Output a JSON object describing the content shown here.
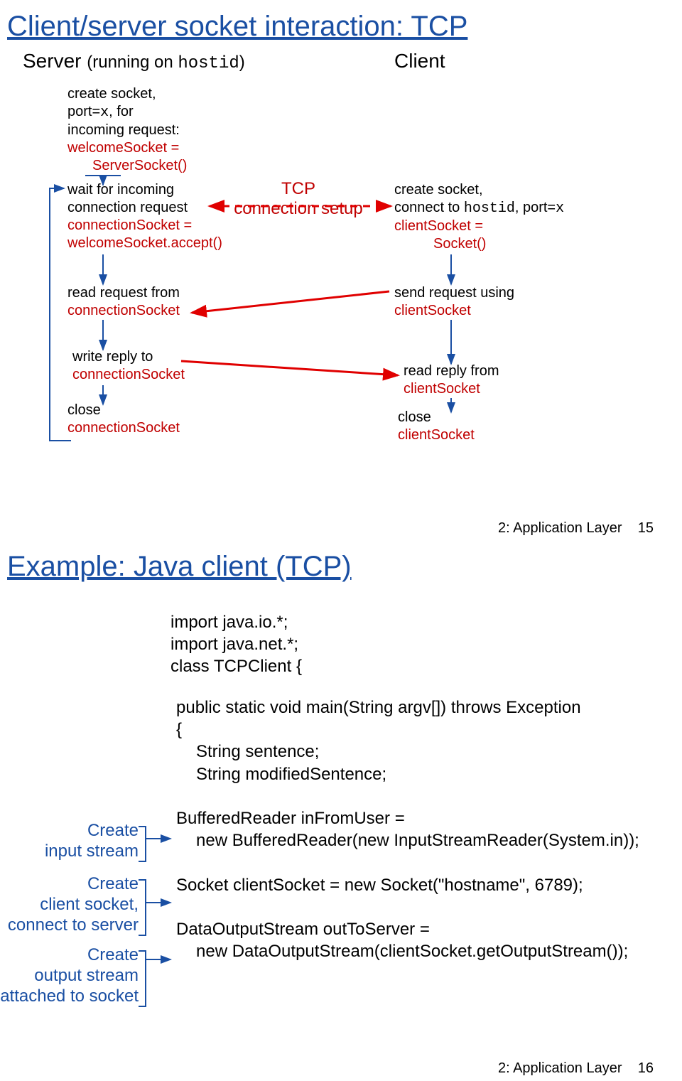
{
  "slide1": {
    "title": "Client/server socket interaction: TCP",
    "server_heading_pre": "Server ",
    "server_heading_paren_open": "(running on ",
    "server_heading_hostid": "hostid",
    "server_heading_paren_close": ")",
    "client_heading": "Client",
    "welcome": {
      "l1": "create socket,",
      "l2_pre": "port=",
      "l2_x": "x",
      "l2_post": ", for",
      "l3": "incoming request:",
      "l4a": "welcomeSocket =",
      "l4b": "ServerSocket()"
    },
    "wait": {
      "l1": "wait for incoming",
      "l2": "connection request",
      "l3": "connectionSocket =",
      "l4": "welcomeSocket.accept()"
    },
    "tcp_label_l1": "TCP",
    "tcp_label_l2": "connection setup",
    "client_create": {
      "l1": "create socket,",
      "l2_pre": "connect to ",
      "l2_hostid": "hostid",
      "l2_mid": ", port=",
      "l2_x": "x",
      "l3": "clientSocket =",
      "l4": "Socket()"
    },
    "read_req_l1": "read request from",
    "read_req_l2": "connectionSocket",
    "send_req_l1": "send request using",
    "send_req_l2": "clientSocket",
    "write_l1": "write reply to",
    "write_l2": "connectionSocket",
    "read_rep_l1": "read reply from",
    "read_rep_l2": "clientSocket",
    "close_s_l1": "close",
    "close_s_l2": "connectionSocket",
    "close_c_l1": "close",
    "close_c_l2": "clientSocket",
    "footer_label": "2: Application Layer",
    "footer_num": "15"
  },
  "slide2": {
    "title": "Example: Java client (TCP)",
    "code_top_l1": "import java.io.*;",
    "code_top_l2": "import java.net.*;",
    "code_top_l3": "class TCPClient {",
    "code_mid_l1": "public static void main(String argv[]) throws Exception",
    "code_mid_l2": "{",
    "code_mid_l3": "String sentence;",
    "code_mid_l4": "String modifiedSentence;",
    "code_blk2_l1": "BufferedReader inFromUser =",
    "code_blk2_l2": "new BufferedReader(new InputStreamReader(System.in));",
    "code_blk3_l1": "Socket clientSocket = new Socket(\"hostname\", 6789);",
    "code_blk4_l1": "DataOutputStream outToServer =",
    "code_blk4_l2": "new DataOutputStream(clientSocket.getOutputStream());",
    "annot1_l1": "Create",
    "annot1_l2": "input stream",
    "annot2_l1": "Create",
    "annot2_l2": "client socket,",
    "annot2_l3": "connect to server",
    "annot3_l1": "Create",
    "annot3_l2": "output stream",
    "annot3_l3": "attached to socket",
    "footer_label": "2: Application Layer",
    "footer_num": "16"
  }
}
